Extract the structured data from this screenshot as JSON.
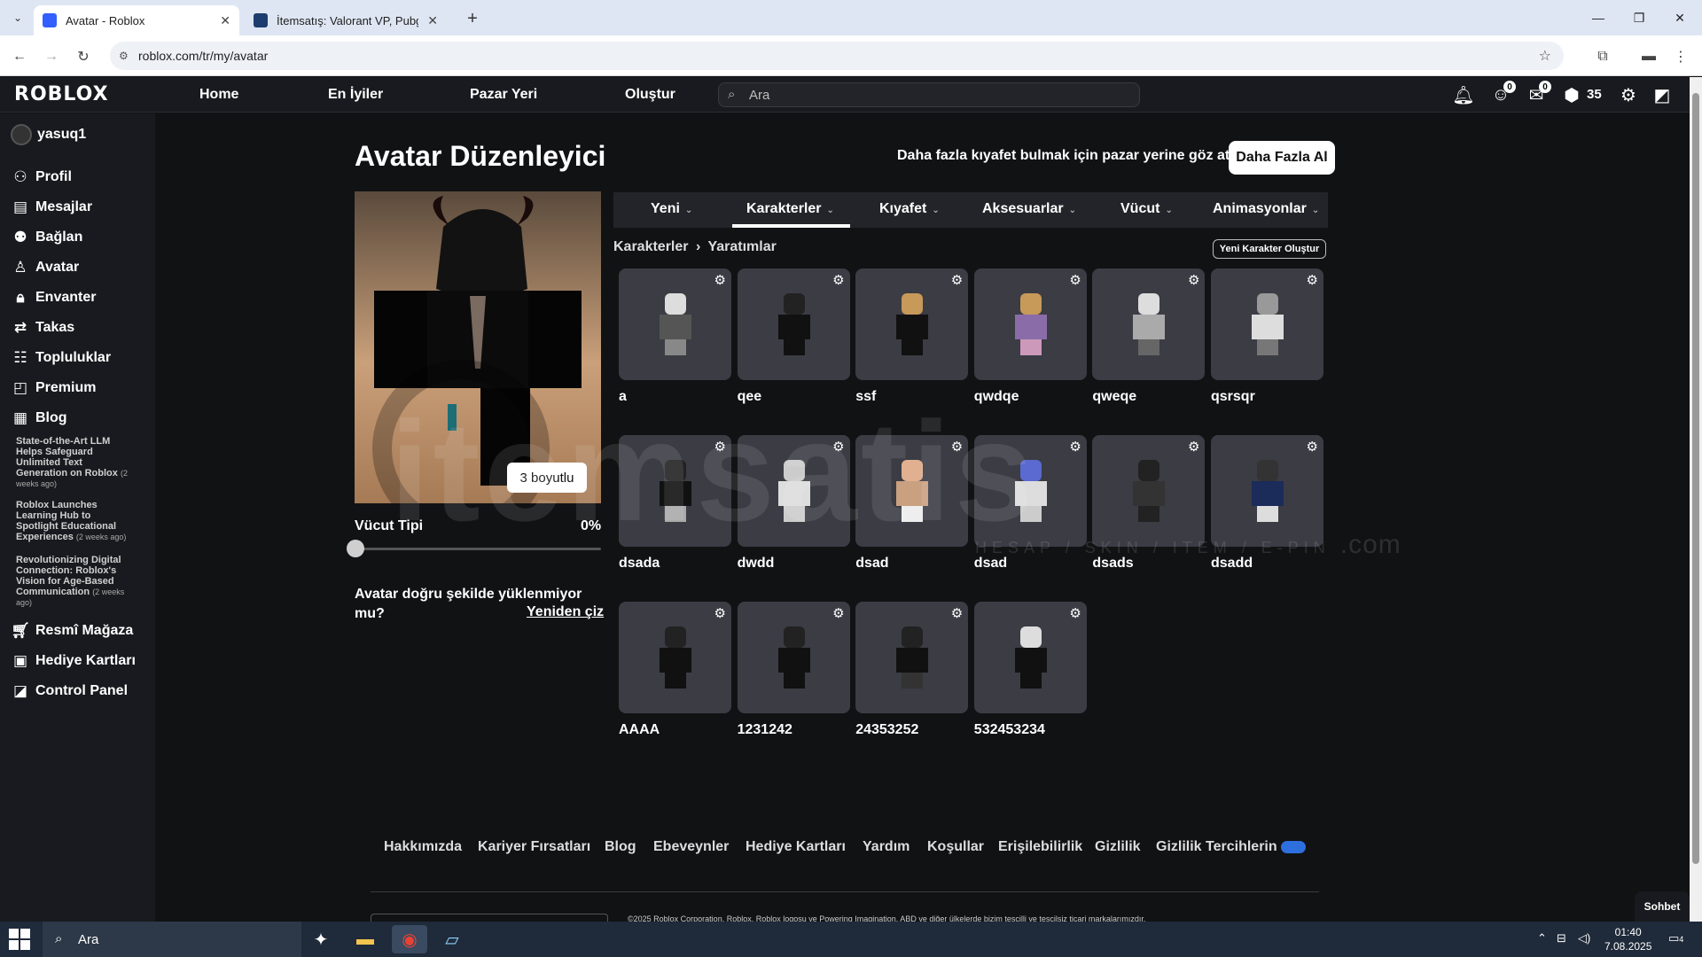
{
  "browser": {
    "tabs": [
      {
        "title": "Avatar - Roblox",
        "active": true
      },
      {
        "title": "İtemsatış: Valorant VP, Pubg Mo",
        "active": false
      }
    ],
    "url": "roblox.com/tr/my/avatar"
  },
  "topnav": {
    "logo": "ROBLOX",
    "links": [
      "Home",
      "En İyiler",
      "Pazar Yeri",
      "Oluştur"
    ],
    "search_placeholder": "Ara",
    "notif_badges": {
      "friends": "0",
      "messages": "0"
    },
    "robux": "35"
  },
  "sidebar": {
    "username": "yasuq1",
    "items": [
      {
        "label": "Profil",
        "icon": "user-icon"
      },
      {
        "label": "Mesajlar",
        "icon": "message-icon"
      },
      {
        "label": "Bağlan",
        "icon": "friends-icon"
      },
      {
        "label": "Avatar",
        "icon": "avatar-icon"
      },
      {
        "label": "Envanter",
        "icon": "inventory-icon"
      },
      {
        "label": "Takas",
        "icon": "trade-icon"
      },
      {
        "label": "Topluluklar",
        "icon": "groups-icon"
      },
      {
        "label": "Premium",
        "icon": "premium-icon"
      },
      {
        "label": "Blog",
        "icon": "blog-icon"
      }
    ],
    "news": [
      {
        "title": "State-of-the-Art LLM Helps Safeguard Unlimited Text Generation on Roblox",
        "ago": "(2 weeks ago)"
      },
      {
        "title": "Roblox Launches Learning Hub to Spotlight Educational Experiences",
        "ago": "(2 weeks ago)"
      },
      {
        "title": "Revolutionizing Digital Connection: Roblox's Vision for Age-Based Communication",
        "ago": "(2 weeks ago)"
      }
    ],
    "bottom_items": [
      {
        "label": "Resmî Mağaza",
        "icon": "shop-icon"
      },
      {
        "label": "Hediye Kartları",
        "icon": "gift-card-icon"
      },
      {
        "label": "Control Panel",
        "icon": "control-panel-icon"
      }
    ]
  },
  "main": {
    "title": "Avatar Düzenleyici",
    "promo": "Daha fazla kıyafet bulmak için pazar yerine göz at!",
    "get_more": "Daha Fazla Al",
    "toggle_3d": "3 boyutlu",
    "body_type_label": "Vücut Tipi",
    "body_type_value": "0%",
    "body_type_level": 0,
    "not_loading": "Avatar doğru şekilde yüklenmiyor mu?",
    "redraw": "Yeniden çiz",
    "tabs": [
      "Yeni",
      "Karakterler",
      "Kıyafet",
      "Aksesuarlar",
      "Vücut",
      "Animasyonlar"
    ],
    "active_tab": "Karakterler",
    "breadcrumb": {
      "parent": "Karakterler",
      "sep": "›",
      "current": "Yaratımlar"
    },
    "new_character": "Yeni Karakter Oluştur",
    "characters": [
      {
        "name": "a"
      },
      {
        "name": "qee"
      },
      {
        "name": "ssf"
      },
      {
        "name": "qwdqe"
      },
      {
        "name": "qweqe"
      },
      {
        "name": "qsrsqr"
      },
      {
        "name": "dsada"
      },
      {
        "name": "dwdd"
      },
      {
        "name": "dsad"
      },
      {
        "name": "dsad"
      },
      {
        "name": "dsads"
      },
      {
        "name": "dsadd"
      },
      {
        "name": "AAAA"
      },
      {
        "name": "1231242"
      },
      {
        "name": "24353252"
      },
      {
        "name": "532453234"
      }
    ]
  },
  "watermark": {
    "main": "itemsatis",
    "sub": "HESAP / SKIN / ITEM / E-PIN",
    "suffix": ".com"
  },
  "footer": {
    "links": [
      "Hakkımızda",
      "Kariyer Fırsatları",
      "Blog",
      "Ebeveynler",
      "Hediye Kartları",
      "Yardım",
      "Koşullar",
      "Erişilebilirlik",
      "Gizlilik",
      "Gizlilik Tercihlerin"
    ],
    "copyright": "©2025 Roblox Corporation. Roblox, Roblox logosu ve Powering Imagination, ABD ve diğer ülkelerde bizim tescilli ve tescilsiz ticari markalarımızdır."
  },
  "chat": "Sohbet",
  "taskbar": {
    "search": "Ara",
    "time": "01:40",
    "date": "7.08.2025",
    "notifications": "4"
  }
}
